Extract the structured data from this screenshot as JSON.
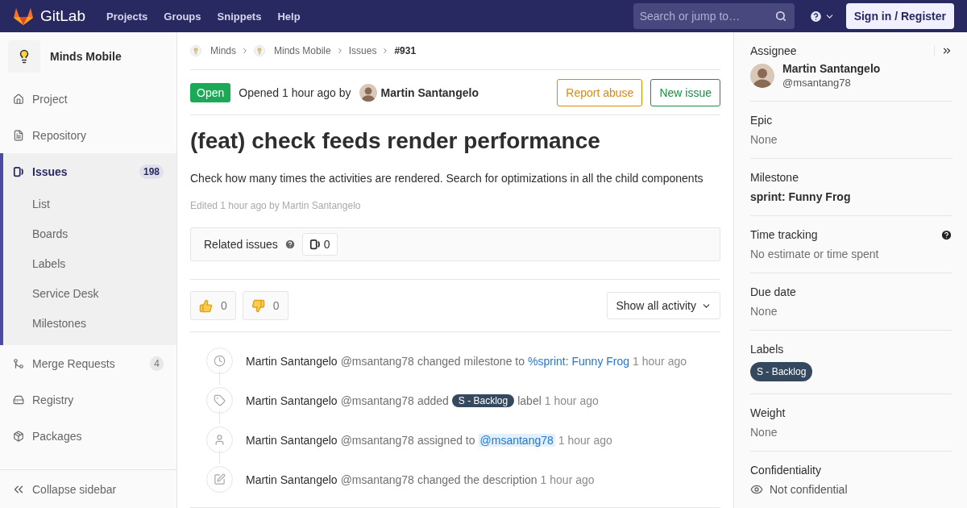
{
  "navbar": {
    "brand": "GitLab",
    "links": [
      "Projects",
      "Groups",
      "Snippets",
      "Help"
    ],
    "search": {
      "placeholder": "Search or jump to…"
    },
    "sign_in": "Sign in / Register"
  },
  "sidebar": {
    "project": "Minds Mobile",
    "items": [
      {
        "kind": "home",
        "label": "Project",
        "selected": false
      },
      {
        "kind": "file",
        "label": "Repository",
        "selected": false
      },
      {
        "kind": "issues",
        "label": "Issues",
        "count": "198",
        "selected": true,
        "children": [
          {
            "label": "List",
            "selected": false
          },
          {
            "label": "Boards",
            "selected": false
          },
          {
            "label": "Labels",
            "selected": false
          },
          {
            "label": "Service Desk",
            "selected": false
          },
          {
            "label": "Milestones",
            "selected": false
          }
        ]
      },
      {
        "kind": "merge",
        "label": "Merge Requests",
        "count": "4",
        "selected": false
      },
      {
        "kind": "registry",
        "label": "Registry",
        "selected": false
      },
      {
        "kind": "package",
        "label": "Packages",
        "selected": false
      }
    ],
    "collapse": "Collapse sidebar"
  },
  "breadcrumbs": [
    {
      "kind": "group",
      "label": "Minds"
    },
    {
      "kind": "group",
      "label": "Minds Mobile"
    },
    {
      "kind": "page",
      "label": "Issues"
    },
    {
      "kind": "current",
      "label": "#931"
    }
  ],
  "issue": {
    "status": "Open",
    "opened": "Opened 1 hour ago by",
    "author": "Martin Santangelo",
    "report": "Report abuse",
    "new_issue": "New issue",
    "title": "(feat) check feeds render performance",
    "description": "Check how many times the activities are rendered. Search for optimizations in all the child components",
    "edited": "Edited 1 hour ago by Martin Santangelo",
    "related": {
      "label": "Related issues",
      "count": "0"
    },
    "awards": [
      {
        "kind": "up",
        "count": "0"
      },
      {
        "kind": "down",
        "count": "0"
      }
    ],
    "activity_filter": "Show all activity"
  },
  "activity": [
    {
      "kind": "milestone",
      "author": "Martin Santangelo",
      "handle": "@msantang78",
      "action": "changed milestone to",
      "link": "%sprint: Funny Frog",
      "time": "1 hour ago"
    },
    {
      "kind": "label",
      "author": "Martin Santangelo",
      "handle": "@msantang78",
      "action": "added",
      "label": "S - Backlog",
      "suffix": "label",
      "time": "1 hour ago"
    },
    {
      "kind": "assignee",
      "author": "Martin Santangelo",
      "handle": "@msantang78",
      "action": "assigned to",
      "mention": "@msantang78",
      "time": "1 hour ago"
    },
    {
      "kind": "description",
      "author": "Martin Santangelo",
      "handle": "@msantang78",
      "action": "changed the description",
      "time": "1 hour ago"
    }
  ],
  "right_sidebar": {
    "assignee": {
      "title": "Assignee",
      "name": "Martin Santangelo",
      "handle": "@msantang78"
    },
    "sections": [
      {
        "kind": "text",
        "title": "Epic",
        "value": "None"
      },
      {
        "kind": "bold",
        "title": "Milestone",
        "value": "sprint: Funny Frog"
      },
      {
        "kind": "help",
        "title": "Time tracking",
        "value": "No estimate or time spent"
      },
      {
        "kind": "text",
        "title": "Due date",
        "value": "None"
      },
      {
        "kind": "label",
        "title": "Labels",
        "value": "S - Backlog"
      },
      {
        "kind": "text",
        "title": "Weight",
        "value": "None"
      },
      {
        "kind": "eye",
        "title": "Confidentiality",
        "value": "Not confidential"
      }
    ]
  }
}
